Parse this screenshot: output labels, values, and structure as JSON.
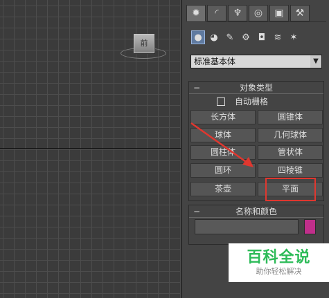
{
  "viewport": {
    "viewcube_label": "前"
  },
  "command_panel": {
    "tabs": [
      {
        "icon": "create-sun-icon",
        "glyph": "✹"
      },
      {
        "icon": "modify-curve-icon",
        "glyph": "◜"
      },
      {
        "icon": "hierarchy-icon",
        "glyph": "♆"
      },
      {
        "icon": "motion-icon",
        "glyph": "◎"
      },
      {
        "icon": "display-monitor-icon",
        "glyph": "▣"
      },
      {
        "icon": "utilities-hammer-icon",
        "glyph": "⚒"
      }
    ],
    "subcategories": [
      {
        "icon": "geometry-sphere-icon",
        "glyph": "●"
      },
      {
        "icon": "shapes-icon",
        "glyph": "◕"
      },
      {
        "icon": "lights-icon",
        "glyph": "✎"
      },
      {
        "icon": "cameras-icon",
        "glyph": "⚙"
      },
      {
        "icon": "helpers-icon",
        "glyph": "◘"
      },
      {
        "icon": "spacewarps-icon",
        "glyph": "≋"
      },
      {
        "icon": "systems-icon",
        "glyph": "✶"
      }
    ],
    "category_dropdown": {
      "selected": "标准基本体",
      "arrow": "▼"
    },
    "object_type": {
      "title": "对象类型",
      "collapse": "−",
      "autogrid_label": "自动栅格",
      "buttons": [
        "长方体",
        "圆锥体",
        "球体",
        "几何球体",
        "圆柱体",
        "管状体",
        "圆环",
        "四棱锥",
        "茶壶",
        "平面"
      ]
    },
    "name_color": {
      "title": "名称和颜色",
      "collapse": "−",
      "name_value": "",
      "color": "#c02f8b"
    }
  },
  "watermark": {
    "main": "百科全说",
    "sub": "助你轻松解决"
  }
}
